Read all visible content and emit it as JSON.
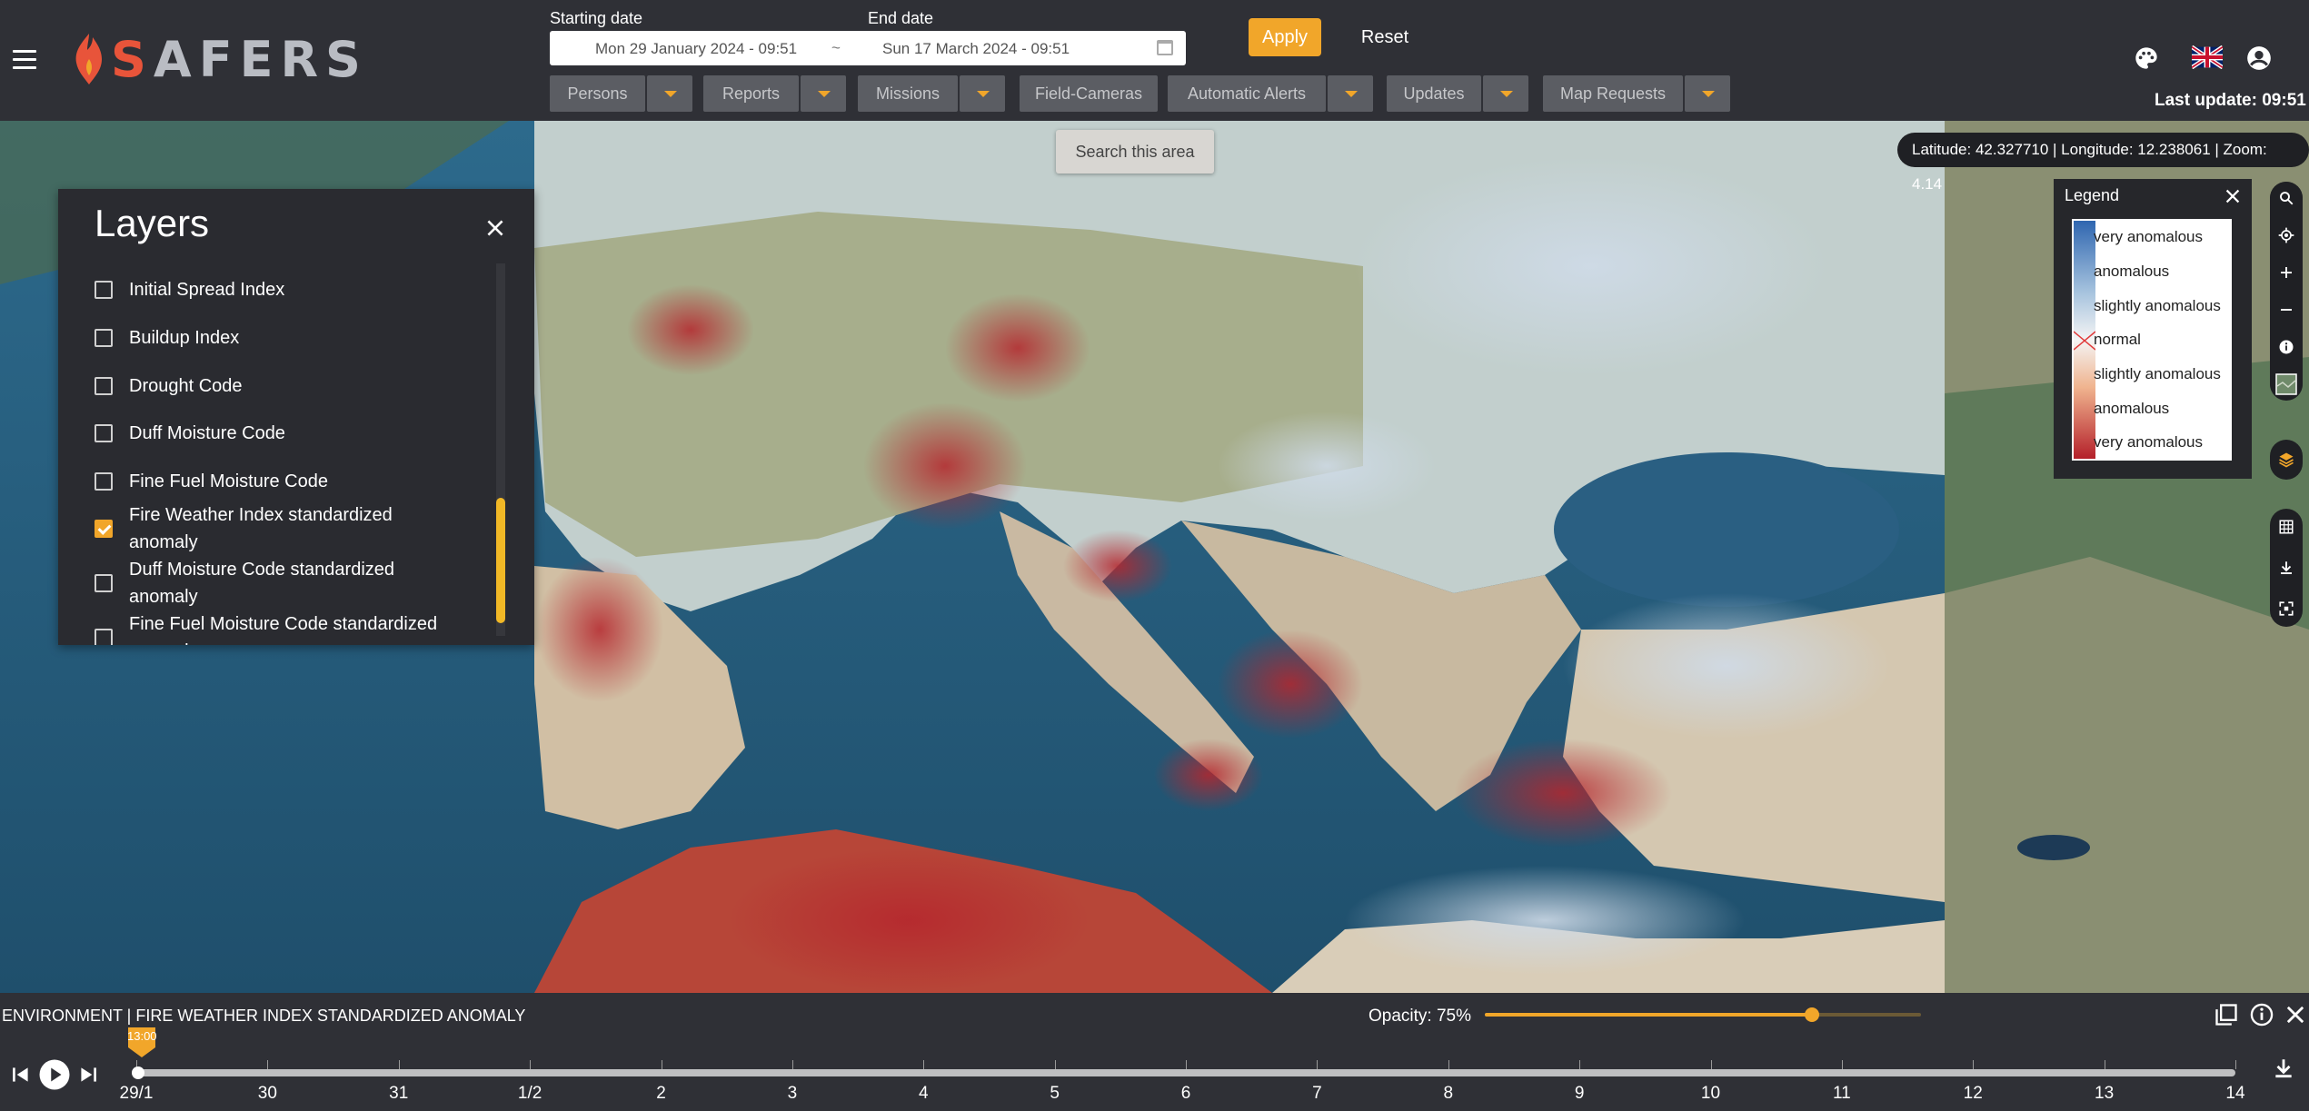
{
  "header": {
    "logo_text": "SAFERS",
    "start_date_label": "Starting date",
    "end_date_label": "End date",
    "start_date_value": "Mon 29 January 2024 - 09:51",
    "date_separator": "~",
    "end_date_value": "Sun 17 March 2024 - 09:51",
    "apply_label": "Apply",
    "reset_label": "Reset",
    "filters": [
      {
        "label": "Persons"
      },
      {
        "label": "Reports"
      },
      {
        "label": "Missions"
      },
      {
        "label": "Field-Cameras"
      },
      {
        "label": "Automatic Alerts"
      },
      {
        "label": "Updates"
      },
      {
        "label": "Map Requests"
      }
    ],
    "last_update": "Last update: 09:51",
    "icons": [
      "menu-icon",
      "palette-icon",
      "uk-flag-icon",
      "account-icon"
    ]
  },
  "map": {
    "search_area_label": "Search this area",
    "coords_text": "Latitude: 42.327710 | Longitude: 12.238061 | Zoom: 4.14"
  },
  "layers": {
    "title": "Layers",
    "items": [
      {
        "label": "Initial Spread Index",
        "checked": false
      },
      {
        "label": "Buildup Index",
        "checked": false
      },
      {
        "label": "Drought Code",
        "checked": false
      },
      {
        "label": "Duff Moisture Code",
        "checked": false
      },
      {
        "label": "Fine Fuel Moisture Code",
        "checked": false
      },
      {
        "label": "Fire Weather Index standardized anomaly",
        "checked": true
      },
      {
        "label": "Duff Moisture Code standardized anomaly",
        "checked": false
      },
      {
        "label": "Fine Fuel Moisture Code standardized anomaly",
        "checked": false
      }
    ]
  },
  "legend": {
    "title": "Legend",
    "rows": [
      {
        "label": "very anomalous"
      },
      {
        "label": "anomalous"
      },
      {
        "label": "slightly anomalous"
      },
      {
        "label": "normal"
      },
      {
        "label": "slightly anomalous"
      },
      {
        "label": "anomalous"
      },
      {
        "label": "very anomalous"
      }
    ],
    "colors": {
      "cold": "#2f66b0",
      "neutral": "#f4f4f4",
      "hot": "#b4202a"
    }
  },
  "bottom": {
    "layer_name": "ENVIRONMENT | FIRE WEATHER INDEX STANDARDIZED ANOMALY",
    "opacity_label": "Opacity: 75%",
    "opacity_value": 0.75,
    "timeline_current": "13:00",
    "timeline_labels": [
      "29/1",
      "30",
      "31",
      "1/2",
      "2",
      "3",
      "4",
      "5",
      "6",
      "7",
      "8",
      "9",
      "10",
      "11",
      "12",
      "13",
      "14"
    ],
    "timeline_position": 0
  },
  "colors": {
    "accent": "#f1a62a",
    "header_bg": "#2f3036"
  }
}
